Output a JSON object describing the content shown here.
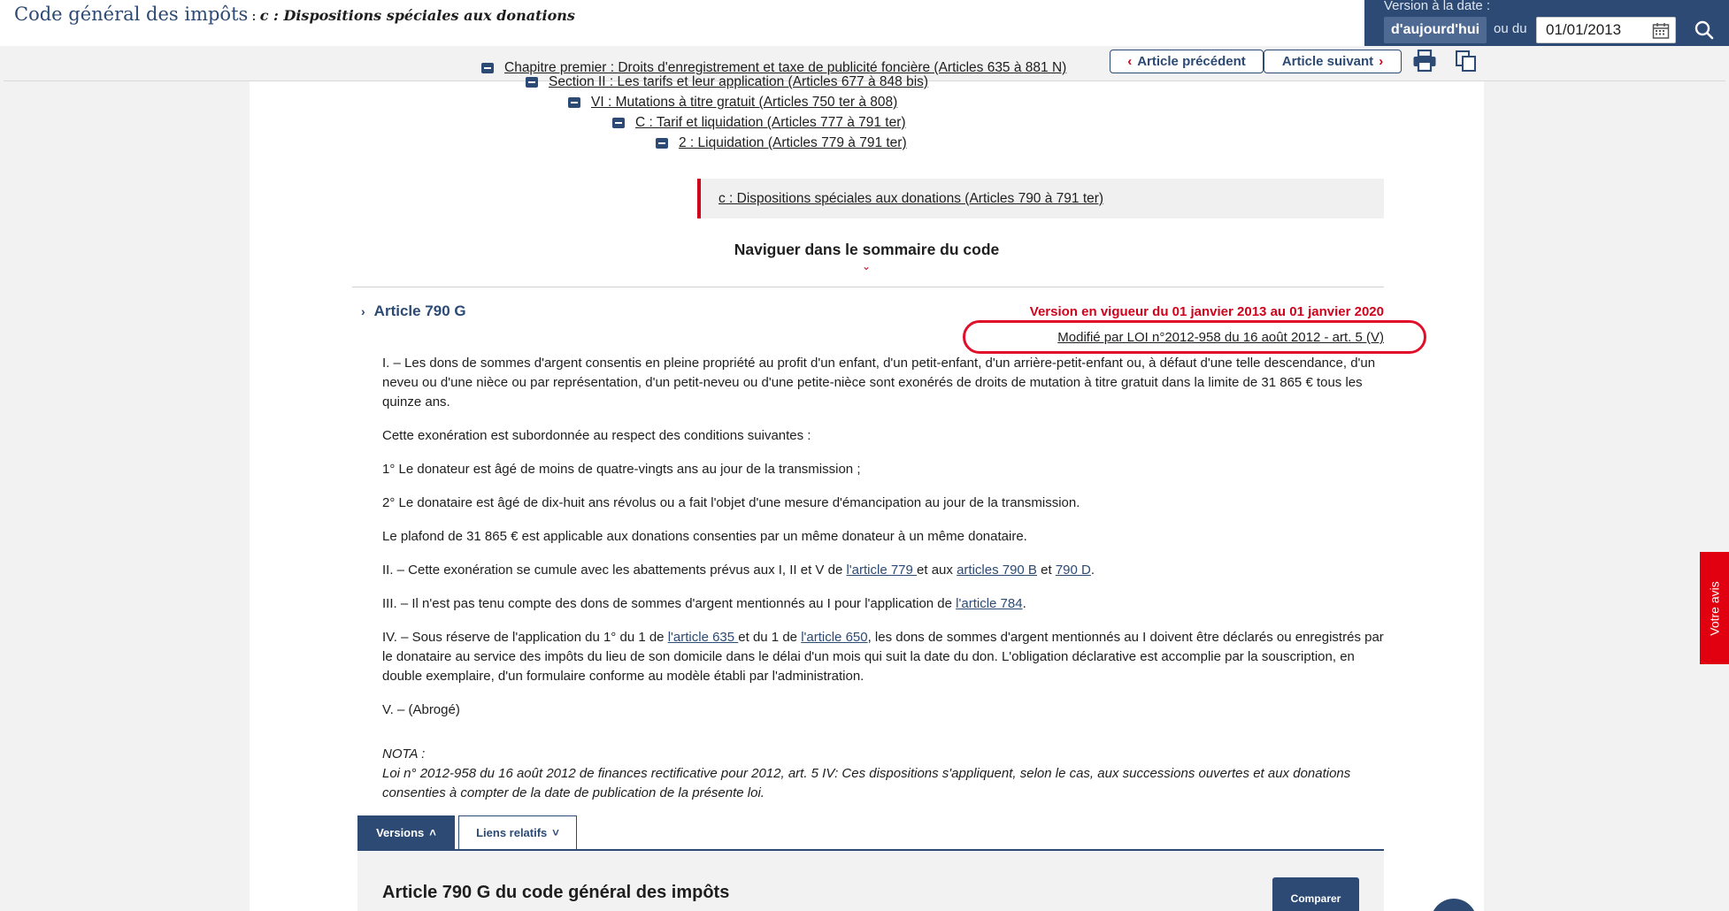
{
  "header": {
    "code_title": "Code général des impôts",
    "separator": ":",
    "section_title": "c : Dispositions spéciales aux donations"
  },
  "version_panel": {
    "label": "Version à la date :",
    "today_button": "d'aujourd'hui",
    "or_label": "ou du",
    "date_value": "01/01/2013"
  },
  "toolbar": {
    "prev_label": "Article précédent",
    "next_label": "Article suivant",
    "prev_chevron": "‹",
    "next_chevron": "›"
  },
  "breadcrumb": {
    "items": [
      "Chapitre premier : Droits d'enregistrement et taxe de publicité foncière (Articles 635 à 881 N)",
      "Section II : Les tarifs et leur application (Articles 677 à 848 bis)",
      "VI : Mutations à titre gratuit (Articles 750 ter à 808)",
      "C : Tarif et liquidation (Articles 777 à 791 ter)",
      "2 : Liquidation (Articles 779 à 791 ter)"
    ],
    "current": "c : Dispositions spéciales aux donations (Articles 790 à 791 ter)"
  },
  "summary_nav": {
    "label": "Naviguer dans le sommaire du code",
    "chevron": "⌄"
  },
  "article": {
    "arrow": "›",
    "title": "Article 790 G",
    "version_status": "Version en vigueur du 01 janvier 2013 au 01 janvier 2020",
    "modified_by": "Modifié par LOI n°2012-958 du 16 août 2012 - art. 5 (V)",
    "p1": "I. – Les dons de sommes d'argent consentis en pleine propriété au profit d'un enfant, d'un petit-enfant, d'un arrière-petit-enfant ou, à défaut d'une telle descendance, d'un neveu ou d'une nièce ou par représentation, d'un petit-neveu ou d'une petite-nièce sont exonérés de droits de mutation à titre gratuit dans la limite de 31 865 € tous les quinze ans.",
    "p2": "Cette exonération est subordonnée au respect des conditions suivantes :",
    "p3": "1° Le donateur est âgé de moins de quatre-vingts ans au jour de la transmission ;",
    "p4": "2° Le donataire est âgé de dix-huit ans révolus ou a fait l'objet d'une mesure d'émancipation au jour de la transmission.",
    "p5": "Le plafond de 31 865 € est applicable aux donations consenties par un même donateur à un même donataire.",
    "p6": {
      "t1": "II. – Cette exonération se cumule avec les abattements prévus aux I, II et V de ",
      "l1": "l'article 779 ",
      "t2": "et aux ",
      "l2": "articles 790 B",
      "t3": " et ",
      "l3": "790 D",
      "t4": "."
    },
    "p7": {
      "t1": "III. – Il n'est pas tenu compte des dons de sommes d'argent mentionnés au I pour l'application de ",
      "l1": "l'article 784",
      "t2": "."
    },
    "p8": {
      "t1": "IV. – Sous réserve de l'application du 1° du 1 de ",
      "l1": "l'article 635 ",
      "t2": "et du 1 de ",
      "l2": "l'article 650",
      "t3": ", les dons de sommes d'argent mentionnés au I doivent être déclarés ou enregistrés par le donataire au service des impôts du lieu de son domicile dans le délai d'un mois qui suit la date du don. L'obligation déclarative est accomplie par la souscription, en double exemplaire, d'un formulaire conforme au modèle établi par l'administration."
    },
    "p9": "V. – (Abrogé)",
    "nota_label": "NOTA :",
    "nota_text": "Loi n° 2012-958 du 16 août 2012 de finances rectificative pour 2012, art. 5 IV: Ces dispositions s'appliquent, selon le cas, aux successions ouvertes et aux donations consenties à compter de la date de publication de la présente loi."
  },
  "tabs": {
    "versions": "Versions",
    "versions_chevron": "˄",
    "liens": "Liens relatifs",
    "liens_chevron": "˅"
  },
  "versions_panel": {
    "heading": "Article 790 G du code général des impôts",
    "compare_button": "Comparer"
  },
  "feedback": {
    "label": "Votre avis"
  },
  "colors": {
    "primary": "#2c4a74",
    "accent_red": "#d0021b",
    "feedback_red": "#e0000f"
  }
}
